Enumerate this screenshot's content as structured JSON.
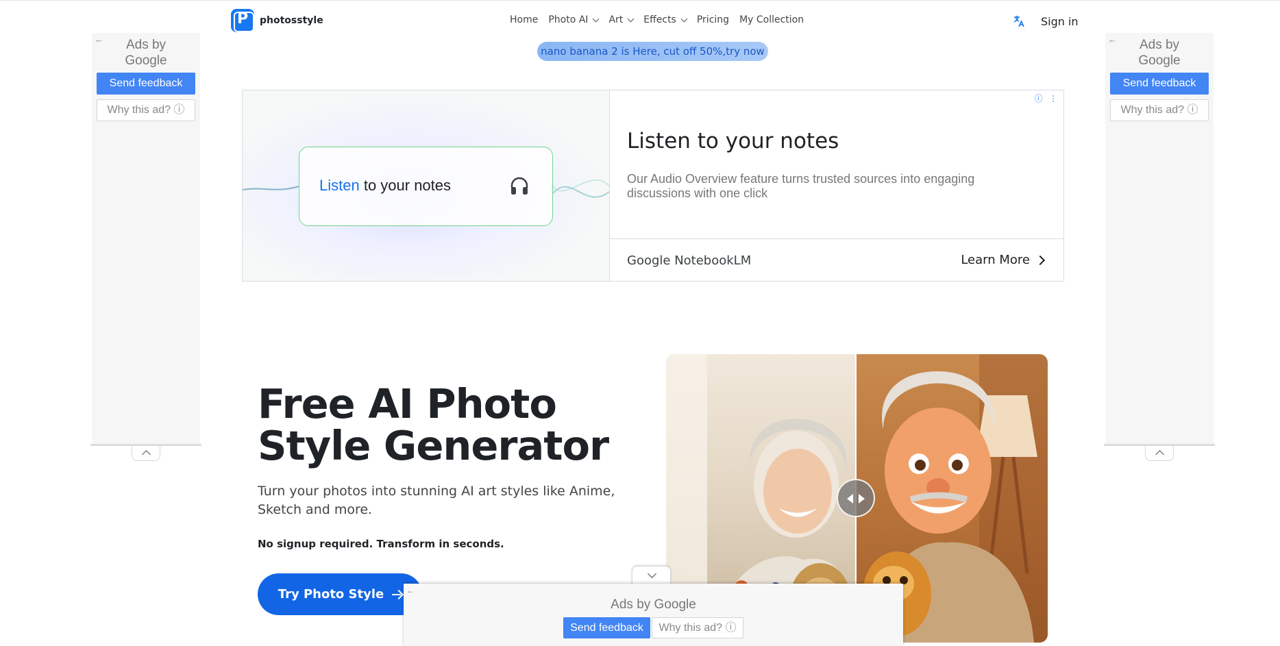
{
  "header": {
    "logo_letter": "P",
    "logo_text": "photosstyle",
    "nav": [
      {
        "label": "Home"
      },
      {
        "label": "Photo AI"
      },
      {
        "label": "Art"
      },
      {
        "label": "Effects"
      },
      {
        "label": "Pricing"
      },
      {
        "label": "My Collection"
      }
    ],
    "lang_icon": "translate-icon",
    "sign_in": "Sign in",
    "promo": "nano banana 2 is Here, cut off 50%,try now"
  },
  "side_ad": {
    "ads_by": "Ads by",
    "google": "Google",
    "send_feedback": "Send feedback",
    "why_this_ad": "Why this ad? ⓘ"
  },
  "banner_ad": {
    "card_highlight": "Listen",
    "card_rest": " to your notes",
    "title": "Listen to your notes",
    "description": "Our Audio Overview feature turns trusted sources into engaging discussions with one click",
    "brand": "Google NotebookLM",
    "cta": "Learn More",
    "info_icons": "ⓘ ⋮"
  },
  "hero": {
    "title": "Free AI Photo Style Generator",
    "subtitle": "Turn your photos into stunning AI art styles like Anime, Sketch and more.",
    "note": "No signup required. Transform in seconds.",
    "cta": "Try Photo Style"
  },
  "anchor_ad": {
    "ads_by": "Ads by Google",
    "send_feedback": "Send feedback",
    "why_this_ad": "Why this ad? ⓘ"
  },
  "colors": {
    "brand_blue": "#1266e6",
    "google_blue": "#4285f4",
    "promo_text": "#1a56c6"
  }
}
